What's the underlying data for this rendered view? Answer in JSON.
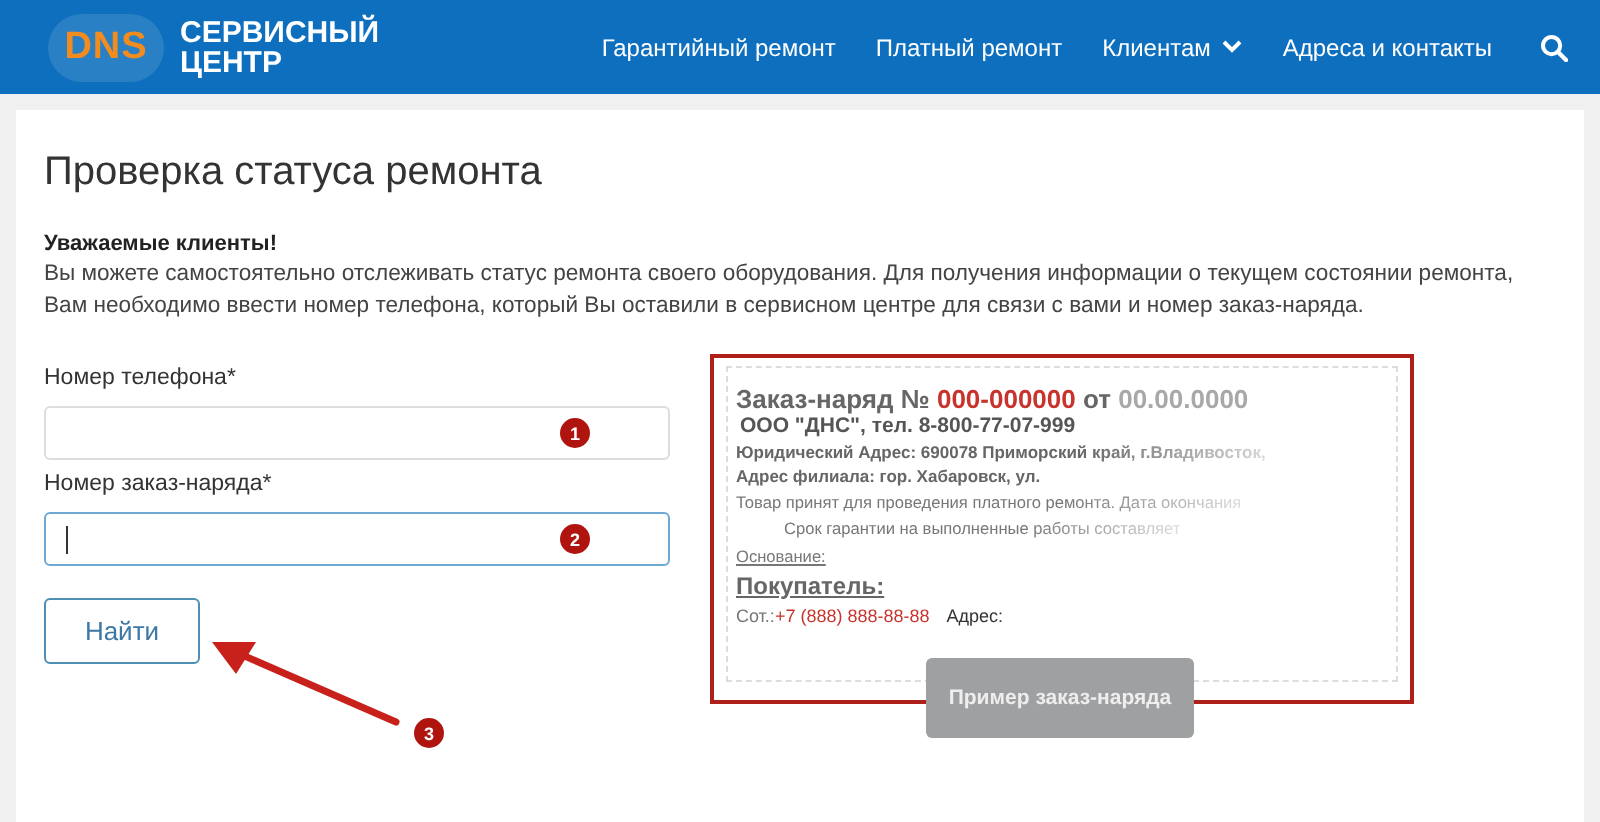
{
  "header": {
    "logo": {
      "brand": "DNS",
      "line_1": "СЕРВИСНЫЙ",
      "line_2": "ЦЕНТР"
    },
    "nav": [
      {
        "label": "Гарантийный ремонт",
        "kind": "link"
      },
      {
        "label": "Платный ремонт",
        "kind": "link"
      },
      {
        "label": "Клиентам",
        "kind": "dropdown"
      },
      {
        "label": "Адреса и контакты",
        "kind": "link"
      },
      {
        "kind": "search"
      }
    ]
  },
  "page": {
    "title": "Проверка статуса ремонта",
    "intro_heading": "Уважаемые клиенты!",
    "intro_text": "Вы можете самостоятельно отслеживать статус ремонта своего оборудования. Для получения информации о текущем состоянии ремонта, Вам необходимо ввести номер телефона, который Вы оставили в сервисном центре для связи с вами и номер заказ-наряда.",
    "fields": [
      {
        "label": "Номер телефона*",
        "focused": false,
        "badge": "1"
      },
      {
        "label": "Номер заказ-наряда*",
        "focused": true,
        "badge": "2"
      }
    ],
    "button": {
      "label": "Найти",
      "badge": "3"
    },
    "sample": {
      "title": "Заказ-наряд №",
      "number": "000-000000",
      "date_prefix": "от",
      "date": "00.00.0000",
      "company": "ООО \"ДНС\", тел. 8-800-77-07-999",
      "legal_address": "Юридический Адрес: 690078 Приморский край, г.Владивосток,",
      "branch_address": "Адрес филиала: гор. Хабаровск, ул.",
      "note": "Товар принят для проведения платного ремонта. Дата окончания",
      "warranty": "Срок гарантии на выполненные работы составляет",
      "basis": "Основание:",
      "buyer": "Покупатель:",
      "phone_label": "Сот.:",
      "phone": "+7 (888) 888-88-88",
      "address_label": "Адрес:",
      "tooltip": "Пример заказ-наряда"
    }
  }
}
